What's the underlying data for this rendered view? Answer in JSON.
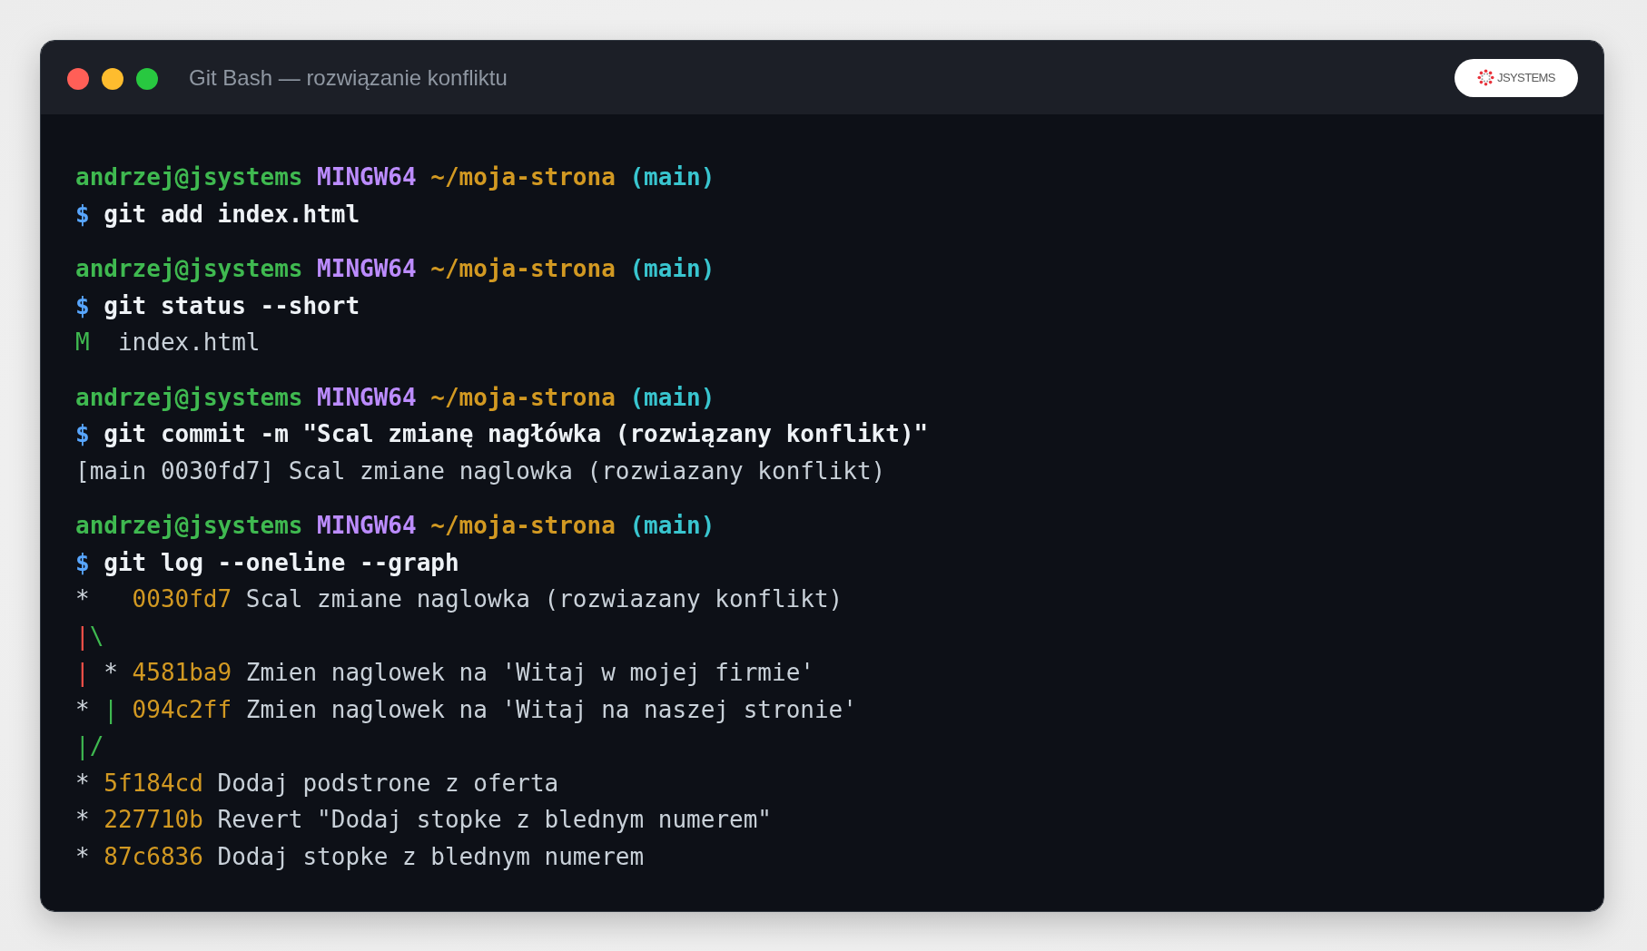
{
  "window": {
    "title": "Git Bash — rozwiązanie konfliktu",
    "logo": {
      "text": "JSYSTEMS"
    }
  },
  "terminal": {
    "blocks": [
      {
        "prompt": {
          "user": "andrzej@jsystems",
          "system": "MINGW64",
          "path": "~/moja-strona",
          "branch": "(main)"
        },
        "command": {
          "sign": "$",
          "text": "git add index.html"
        }
      },
      {
        "prompt": {
          "user": "andrzej@jsystems",
          "system": "MINGW64",
          "path": "~/moja-strona",
          "branch": "(main)"
        },
        "command": {
          "sign": "$",
          "text": "git status --short"
        },
        "output": [
          {
            "kind": "status",
            "code": "M",
            "file": "index.html"
          }
        ]
      },
      {
        "prompt": {
          "user": "andrzej@jsystems",
          "system": "MINGW64",
          "path": "~/moja-strona",
          "branch": "(main)"
        },
        "command": {
          "sign": "$",
          "text": "git commit -m \"Scal zmianę nagłówka (rozwiązany konflikt)\""
        },
        "output": [
          {
            "kind": "text",
            "text": "[main 0030fd7] Scal zmiane naglowka (rozwiazany konflikt)"
          }
        ]
      },
      {
        "prompt": {
          "user": "andrzej@jsystems",
          "system": "MINGW64",
          "path": "~/moja-strona",
          "branch": "(main)"
        },
        "command": {
          "sign": "$",
          "text": "git log --oneline --graph"
        },
        "output": [
          {
            "kind": "graph",
            "graph": [
              {
                "kind": "mark",
                "text": "*",
                "color": "#d0d7de"
              },
              {
                "kind": "space"
              },
              {
                "kind": "space"
              },
              {
                "kind": "space"
              }
            ],
            "hash": "0030fd7",
            "message": "Scal zmiane naglowka (rozwiazany konflikt)"
          },
          {
            "kind": "graph",
            "graph": [
              {
                "kind": "mark",
                "text": "|",
                "color": "#f85149"
              },
              {
                "kind": "mark",
                "text": "\\",
                "color": "#3fb950"
              }
            ]
          },
          {
            "kind": "graph",
            "graph": [
              {
                "kind": "mark",
                "text": "|",
                "color": "#f85149"
              },
              {
                "kind": "space"
              },
              {
                "kind": "mark",
                "text": "*",
                "color": "#d0d7de"
              },
              {
                "kind": "space"
              }
            ],
            "hash": "4581ba9",
            "message": "Zmien naglowek na 'Witaj w mojej firmie'"
          },
          {
            "kind": "graph",
            "graph": [
              {
                "kind": "mark",
                "text": "*",
                "color": "#d0d7de"
              },
              {
                "kind": "space"
              },
              {
                "kind": "mark",
                "text": "|",
                "color": "#3fb950"
              },
              {
                "kind": "space"
              }
            ],
            "hash": "094c2ff",
            "message": "Zmien naglowek na 'Witaj na naszej stronie'"
          },
          {
            "kind": "graph",
            "graph": [
              {
                "kind": "mark",
                "text": "|",
                "color": "#3fb950"
              },
              {
                "kind": "mark",
                "text": "/",
                "color": "#3fb950"
              }
            ]
          },
          {
            "kind": "graph",
            "graph": [
              {
                "kind": "mark",
                "text": "*",
                "color": "#d0d7de"
              },
              {
                "kind": "space"
              }
            ],
            "hash": "5f184cd",
            "message": "Dodaj podstrone z oferta"
          },
          {
            "kind": "graph",
            "graph": [
              {
                "kind": "mark",
                "text": "*",
                "color": "#d0d7de"
              },
              {
                "kind": "space"
              }
            ],
            "hash": "227710b",
            "message": "Revert \"Dodaj stopke z blednym numerem\""
          },
          {
            "kind": "graph",
            "graph": [
              {
                "kind": "mark",
                "text": "*",
                "color": "#d0d7de"
              },
              {
                "kind": "space"
              }
            ],
            "hash": "87c6836",
            "message": "Dodaj stopke z blednym numerem"
          }
        ]
      }
    ]
  }
}
